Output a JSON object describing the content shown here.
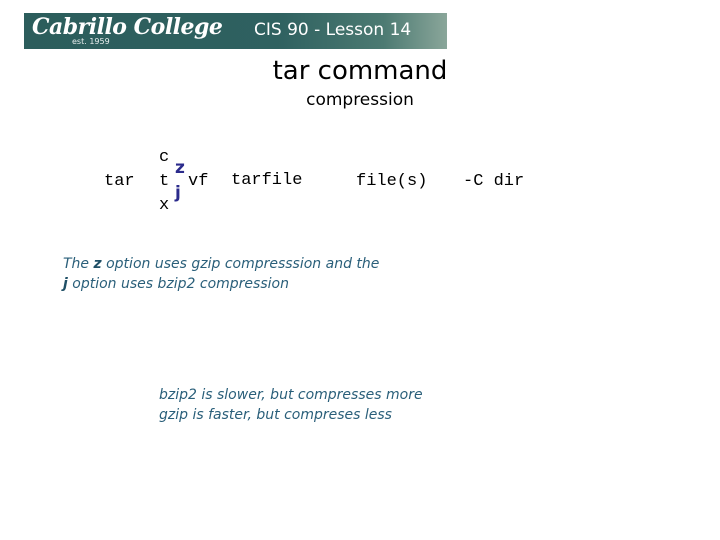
{
  "header": {
    "logo_text": "Cabrillo College",
    "logo_est": "est. 1959",
    "lesson_title": "CIS 90 - Lesson 14"
  },
  "slide": {
    "title": "tar command",
    "subtitle": "compression"
  },
  "syntax": {
    "command": "tar",
    "mode_options": [
      "c",
      "t",
      "x"
    ],
    "compress_options": [
      "z",
      "j"
    ],
    "flags": "vf",
    "tarfile": "tarfile",
    "files": "file(s)",
    "dir_option": "-C dir"
  },
  "notes": {
    "options_line1_pre": "The ",
    "options_z": "z",
    "options_line1_post": " option uses gzip compresssion and the",
    "options_j": "j",
    "options_line2_post": " option uses bzip2 compression",
    "speed_line1": "bzip2 is slower, but compresses more",
    "speed_line2": "gzip is faster, but compreses less"
  },
  "colors": {
    "banner": "#2c5d5c",
    "option_highlight": "#2b2b8c",
    "note_text": "#2a5f7a"
  }
}
